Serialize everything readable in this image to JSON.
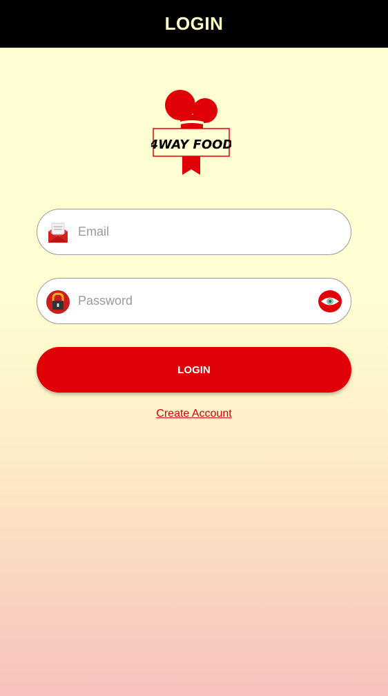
{
  "header": {
    "title": "LOGIN"
  },
  "logo": {
    "text": "4WAY FOOD",
    "icon": "chef-hat-logo"
  },
  "email": {
    "placeholder": "Email",
    "value": "",
    "icon": "envelope-icon"
  },
  "password": {
    "placeholder": "Password",
    "value": "",
    "icon": "padlock-icon",
    "toggle_icon": "eye-icon"
  },
  "login_button": {
    "label": "LOGIN"
  },
  "create_account": {
    "label": "Create Account"
  },
  "colors": {
    "accent": "#e00007",
    "header_bg": "#000000",
    "header_text": "#ffffc8"
  }
}
